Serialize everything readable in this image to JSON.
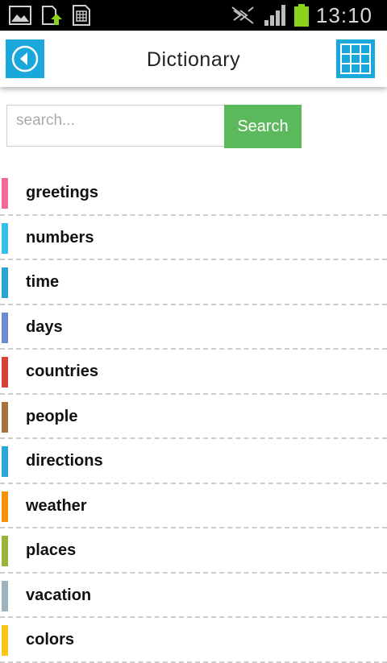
{
  "status_bar": {
    "time": "13:10",
    "icons": [
      "gallery-icon",
      "upload-icon",
      "sd-card-icon",
      "muted-icon",
      "signal-icon",
      "battery-icon"
    ],
    "battery_color": "#8dd21d"
  },
  "header": {
    "title": "Dictionary",
    "accent_color": "#1aa7dc",
    "back_icon": "back-arrow-icon",
    "grid_icon": "grid-icon"
  },
  "search": {
    "placeholder": "search...",
    "value": "",
    "button_label": "Search",
    "button_color": "#5cb85c"
  },
  "categories": [
    {
      "label": "greetings",
      "color": "#f06b9b"
    },
    {
      "label": "numbers",
      "color": "#36c0ea"
    },
    {
      "label": "time",
      "color": "#2aa3d3"
    },
    {
      "label": "days",
      "color": "#6b8dd0"
    },
    {
      "label": "countries",
      "color": "#d9403b"
    },
    {
      "label": "people",
      "color": "#a8733a"
    },
    {
      "label": "directions",
      "color": "#29a6dc"
    },
    {
      "label": "weather",
      "color": "#f7900d"
    },
    {
      "label": "places",
      "color": "#9ab53a"
    },
    {
      "label": "vacation",
      "color": "#9db5bd"
    },
    {
      "label": "colors",
      "color": "#f5c51a"
    }
  ]
}
